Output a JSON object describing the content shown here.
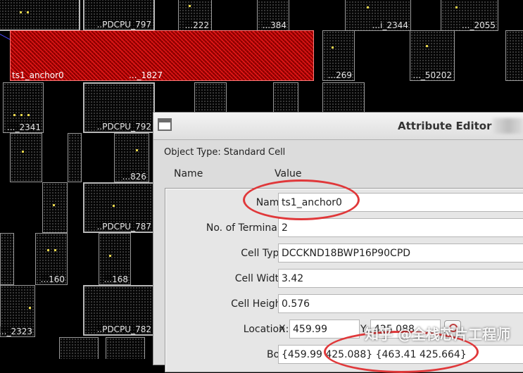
{
  "layout_view": {
    "cell_labels": {
      "c1": "..PDCPU_797",
      "c2": "...222",
      "c3": "...384",
      "c4": "...i_2344",
      "c5": "..._2055",
      "c6": "..._2341",
      "c7": "..PDCPU_792",
      "c8": "...269",
      "c9": "..._50202",
      "c10": "...826",
      "c11": "..PDCPU_787",
      "c12": "...160",
      "c13": "...168",
      "c14": "..._2323",
      "c15": "..PDCPU_782"
    },
    "selected_cell": {
      "label_left": "ts1_anchor0",
      "label_right": "..._1827"
    },
    "colors": {
      "selected_fill": "#c00000",
      "cell_border": "#b8b8b8",
      "pin_dot": "#e8d64a",
      "flyline": "#4a4aff"
    }
  },
  "dialog": {
    "title": "Attribute Editor",
    "object_type_label": "Object Type:",
    "object_type_value": "Standard Cell",
    "col_name": "Name",
    "col_value": "Value",
    "rows": {
      "name": {
        "label": "Name",
        "value": "ts1_anchor0"
      },
      "terminals": {
        "label": "No. of Terminals",
        "value": "2"
      },
      "cell_type": {
        "label": "Cell Type",
        "value": "DCCKND18BWP16P90CPD"
      },
      "cell_width": {
        "label": "Cell Width",
        "value": "3.42"
      },
      "cell_height": {
        "label": "Cell Height",
        "value": "0.576"
      },
      "location": {
        "label": "Location",
        "x_label": "X:",
        "x_value": "459.99",
        "y_label": "Y:",
        "y_value": "425.088"
      },
      "box": {
        "label": "Box",
        "value": "{459.99 425.088} {463.41 425.664}"
      }
    },
    "highlight_color": "#e0383a"
  },
  "watermark": "知乎 @全栈芯片工程师"
}
